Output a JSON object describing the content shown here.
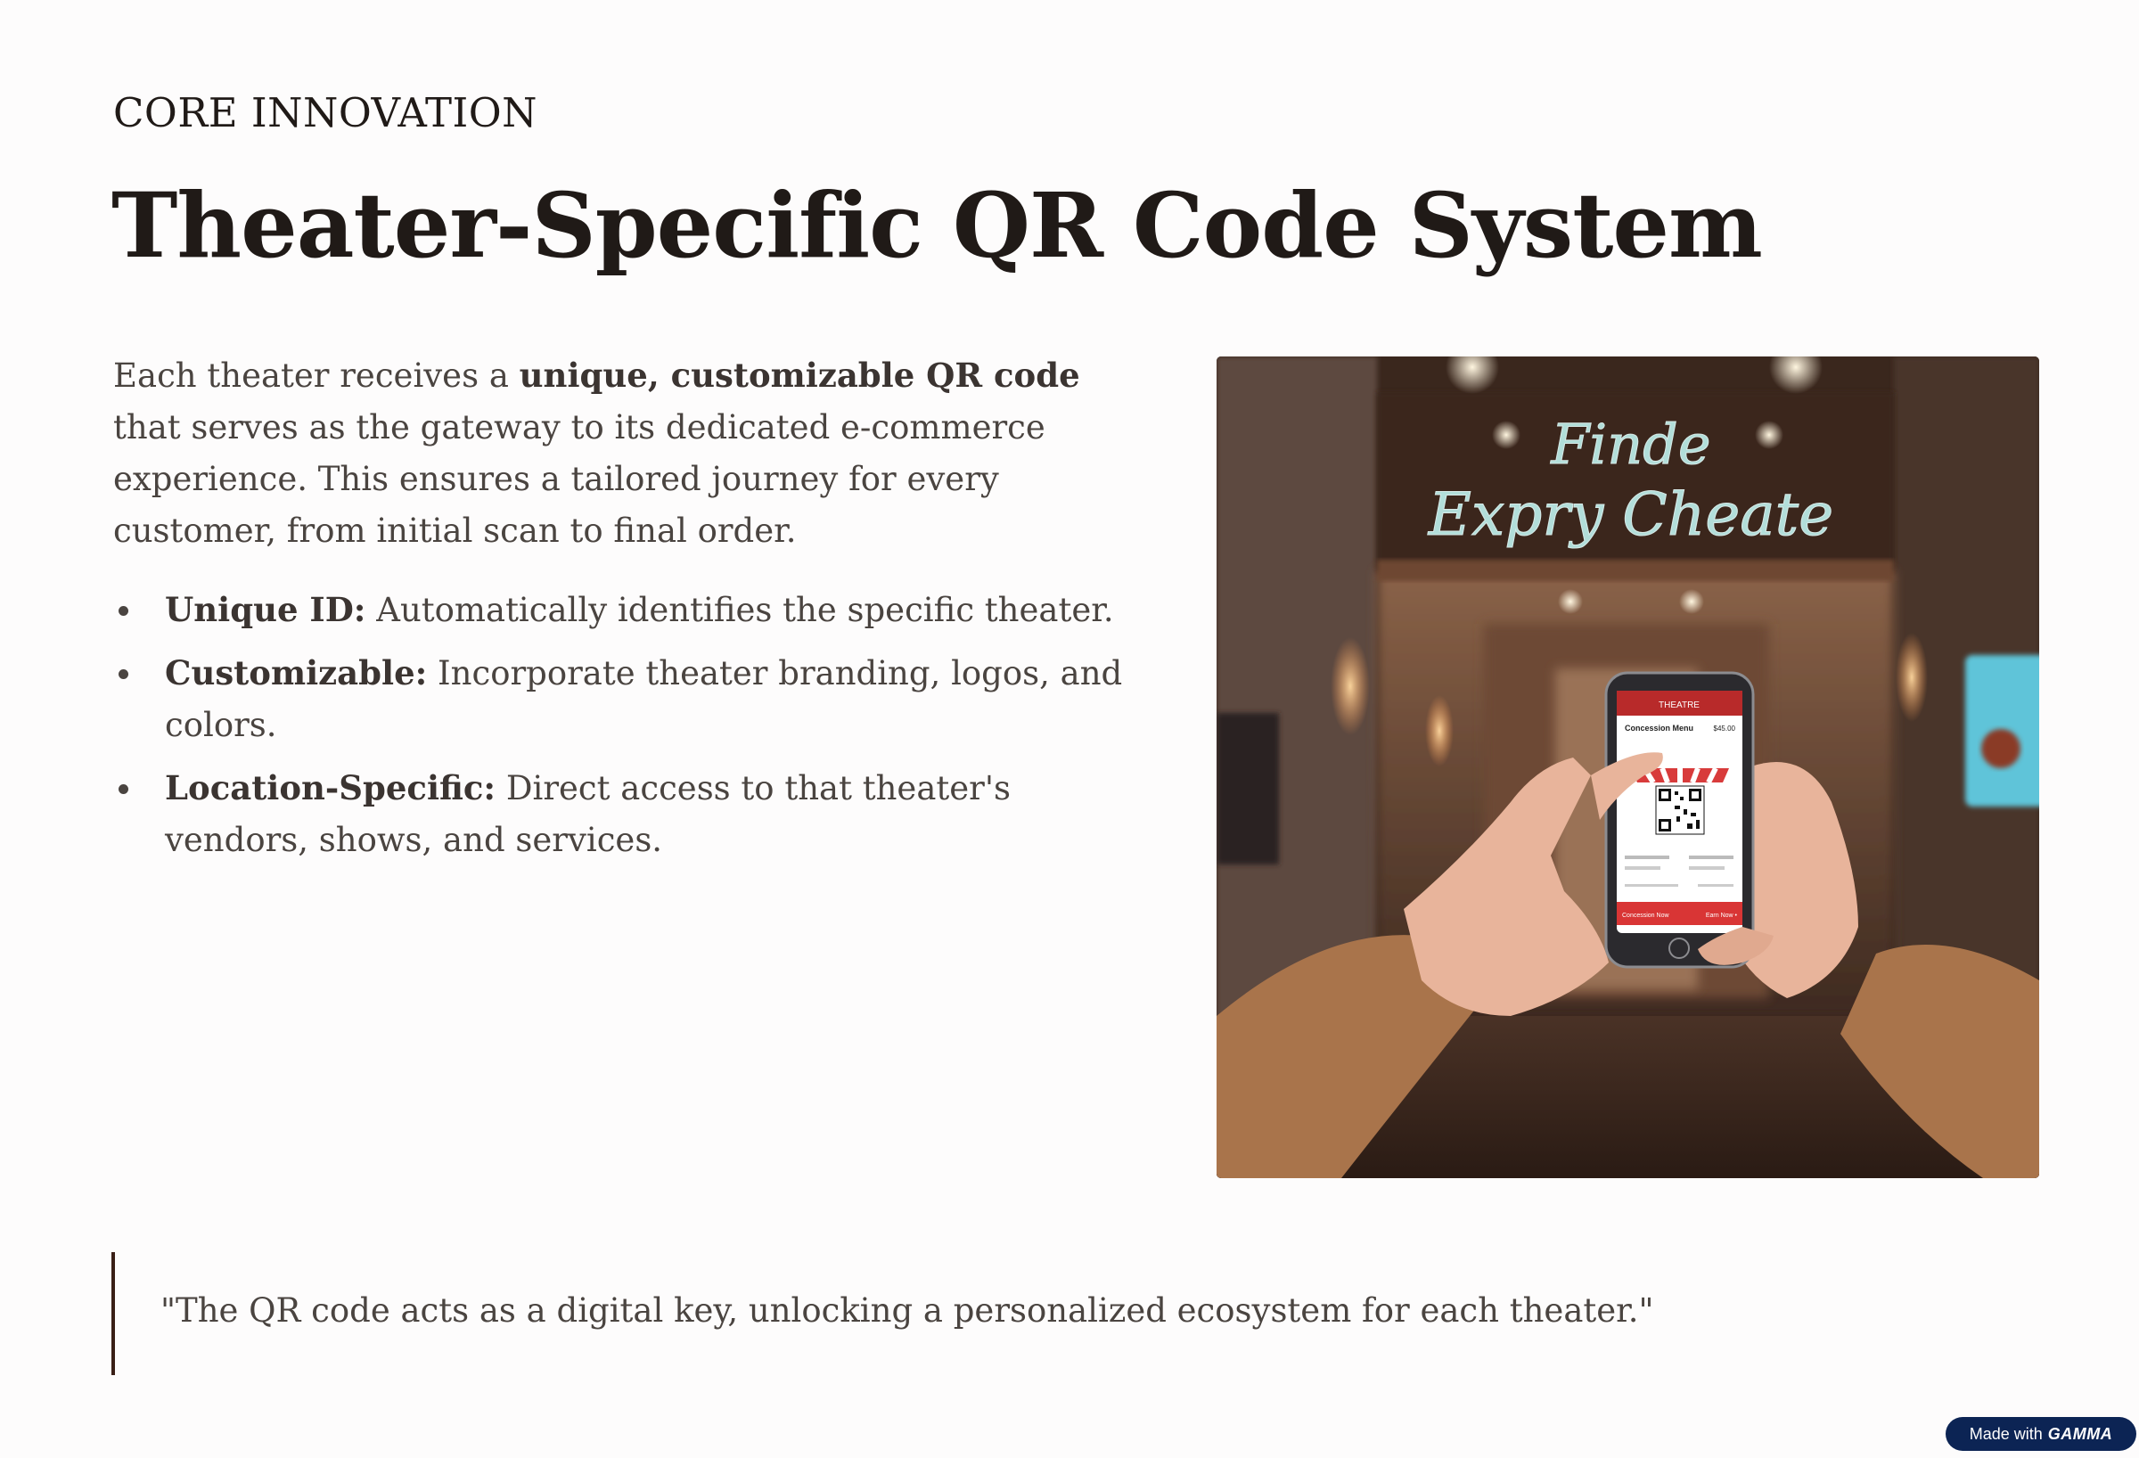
{
  "header": {
    "eyebrow": "CORE INNOVATION",
    "title": "Theater-Specific QR Code System"
  },
  "intro": {
    "before": "Each theater receives a ",
    "bold": "unique, customizable QR code",
    "after": " that serves as the gateway to its dedicated e-commerce experience. This ensures a tailored journey for every customer, from initial scan to final order."
  },
  "bullets": [
    {
      "label": "Unique ID:",
      "text": " Automatically identifies the specific theater."
    },
    {
      "label": "Customizable:",
      "text": " Incorporate theater branding, logos, and colors."
    },
    {
      "label": "Location-Specific:",
      "text": " Direct access to that theater's vendors, shows, and services."
    }
  ],
  "photo": {
    "sign_line1": "Finde",
    "sign_line2": "Expry Cheate",
    "phone_header": "THEATRE",
    "phone_menu_title": "Concession Menu",
    "phone_price": "$45.00",
    "phone_left_button": "Concession Now",
    "phone_right_button": "Earn Now •"
  },
  "quote": "\"The QR code acts as a digital key, unlocking a personalized ecosystem for each theater.\"",
  "badge": {
    "prefix": "Made with",
    "brand": "GAMMA"
  },
  "colors": {
    "text_dark": "#201a17",
    "text_body": "#4a4440",
    "quote_bar": "#3a1f16",
    "badge_bg": "#0c2454",
    "background": "#fdfcfc"
  }
}
